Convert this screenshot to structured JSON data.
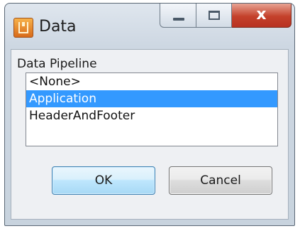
{
  "window": {
    "title": "Data"
  },
  "caption_buttons": {
    "close_glyph": "x"
  },
  "data_pipeline": {
    "label": "Data Pipeline",
    "items": [
      {
        "label": "<None>",
        "selected": false
      },
      {
        "label": "Application",
        "selected": true
      },
      {
        "label": "HeaderAndFooter",
        "selected": false
      }
    ]
  },
  "buttons": {
    "ok_label": "OK",
    "cancel_label": "Cancel"
  },
  "colors": {
    "selection": "#3399ff",
    "close_button": "#c4412b"
  }
}
